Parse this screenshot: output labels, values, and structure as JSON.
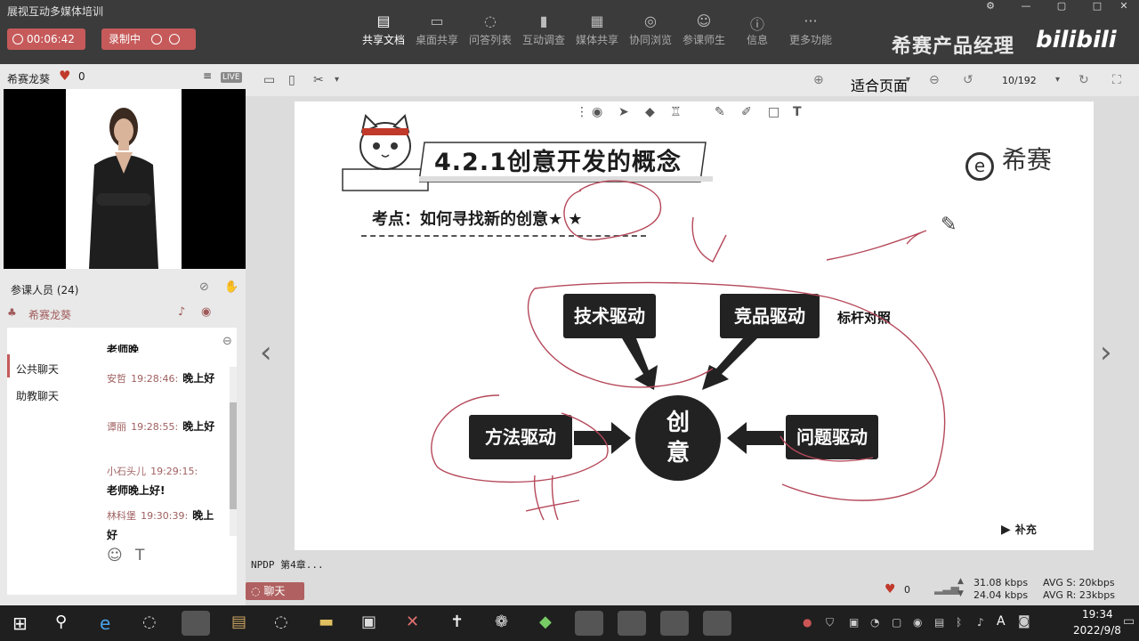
{
  "app": {
    "title": "展视互动多媒体培训",
    "timer": "00:06:42",
    "recording_label": "录制中"
  },
  "toolbar": {
    "items": [
      {
        "label": "共享文档",
        "icon": "document-icon",
        "active": true
      },
      {
        "label": "桌面共享",
        "icon": "desktop-share-icon"
      },
      {
        "label": "问答列表",
        "icon": "qa-icon"
      },
      {
        "label": "互动调查",
        "icon": "survey-icon"
      },
      {
        "label": "媒体共享",
        "icon": "media-icon"
      },
      {
        "label": "协同浏览",
        "icon": "browse-icon"
      },
      {
        "label": "参课师生",
        "icon": "users-icon"
      },
      {
        "label": "信息",
        "icon": "info-icon"
      },
      {
        "label": "更多功能",
        "icon": "more-icon"
      }
    ],
    "brand_text": "希赛产品经理",
    "brand_logo": "bilibili"
  },
  "left": {
    "presenter": "希赛龙葵",
    "likes": "0",
    "live": "LIVE",
    "participants_label": "参课人员 (24)",
    "host": "希赛龙葵",
    "tabs": [
      "公共聊天",
      "助教聊天"
    ],
    "partial_text": "老师晚",
    "messages": [
      {
        "name": "安哲",
        "time": "19:28:46:",
        "text": "晚上好"
      },
      {
        "name": "谭丽",
        "time": "19:28:55:",
        "text": "晚上好"
      },
      {
        "name": "小石头儿",
        "time": "19:29:15:",
        "text": "老师晚上好!"
      },
      {
        "name": "林科堡",
        "time": "19:30:39:",
        "text": "晚上好"
      }
    ],
    "chat_button": "聊天",
    "status_text": "NPDP 第4章..."
  },
  "slide_toolbar": {
    "zoom": "适合页面",
    "page": "10/192"
  },
  "slide": {
    "title": "4.2.1创意开发的概念",
    "subtitle": "考点：如何寻找新的创意★ ★",
    "logo": "希赛",
    "center": [
      "创",
      "意"
    ],
    "drivers": {
      "tech": "技术驱动",
      "competitor": "竞品驱动",
      "method": "方法驱动",
      "problem": "问题驱动"
    },
    "annotation": "标杆对照",
    "supplement": "补充"
  },
  "status": {
    "likes": "0",
    "up_rate": "31.08 kbps",
    "down_rate": "24.04 kbps",
    "avg_s": "AVG S: 20kbps",
    "avg_r": "AVG R: 23kbps"
  },
  "taskbar": {
    "time": "19:34",
    "date": "2022/9/8"
  }
}
